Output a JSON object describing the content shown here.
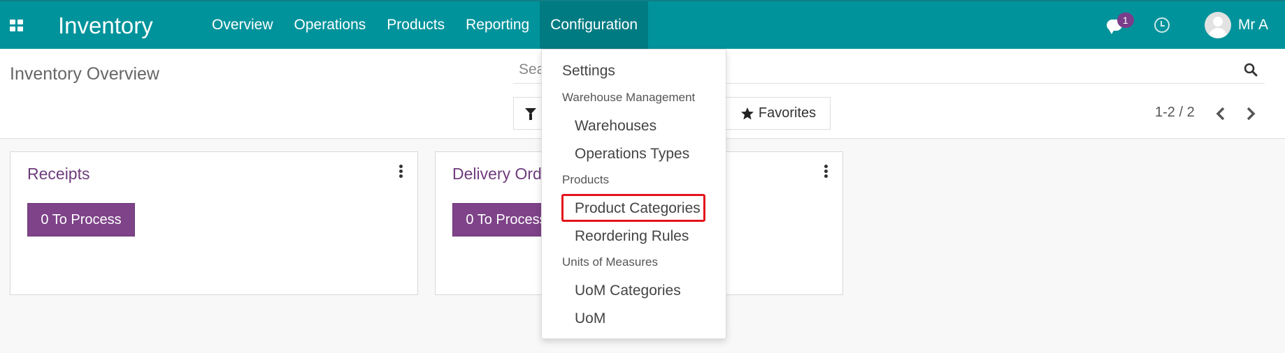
{
  "navbar": {
    "brand": "Inventory",
    "menu": [
      {
        "label": "Overview"
      },
      {
        "label": "Operations"
      },
      {
        "label": "Products"
      },
      {
        "label": "Reporting"
      },
      {
        "label": "Configuration",
        "active": true
      }
    ],
    "chat_badge": "1",
    "username": "Mr A",
    "icons": [
      "apps-icon",
      "chat-icon",
      "clock-icon",
      "avatar"
    ]
  },
  "control_panel": {
    "title": "Inventory Overview",
    "search": {
      "placeholder": "Search...",
      "value": ""
    },
    "favorites_label": "Favorites",
    "pager": "1-2 / 2"
  },
  "cards": [
    {
      "title": "Receipts",
      "button": "0 To Process"
    },
    {
      "title": "Delivery Orders",
      "button": "0 To Process"
    }
  ],
  "dropdown": {
    "settings": "Settings",
    "warehouse_header": "Warehouse Management",
    "warehouses": "Warehouses",
    "operation_types": "Operations Types",
    "products_header": "Products",
    "product_categories": "Product Categories",
    "reordering_rules": "Reordering Rules",
    "uom_header": "Units of Measures",
    "uom_categories": "UoM Categories",
    "uom": "UoM"
  },
  "colors": {
    "navbar": "#00939b",
    "navbar_active": "#007b82",
    "accent_purple": "#7e4388",
    "highlight_red": "#e3131d"
  }
}
